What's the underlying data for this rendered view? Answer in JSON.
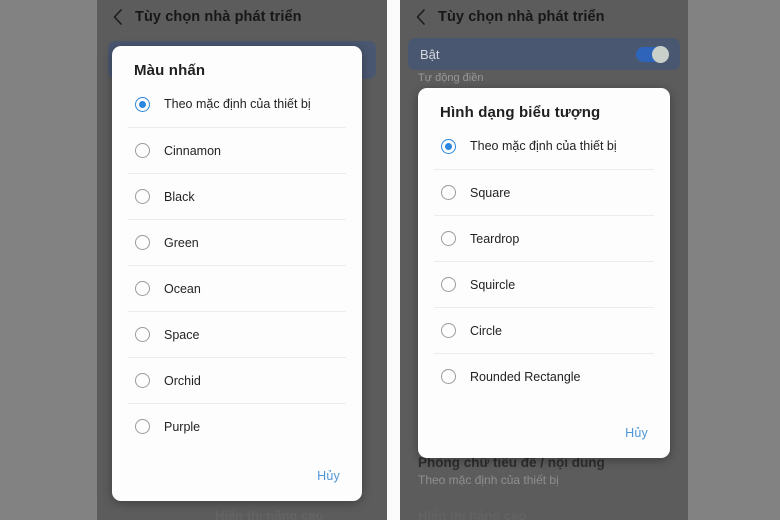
{
  "background": {
    "page_bg": "#828282",
    "screen_dim": "#5c5c5c",
    "gap": "#fbfbfb"
  },
  "theme": {
    "accent_blue": "#2a87e0",
    "link_blue": "#4f96d6",
    "toggle_on": "#2f64bb",
    "card_blue_grey": "#4a5770"
  },
  "left_screen": {
    "appbar": {
      "back_icon": "chevron-left-icon",
      "title": "Tùy chọn nhà phát triển"
    },
    "ghost_bottom": "Hiển thị nâng cao",
    "dialog": {
      "title": "Màu nhấn",
      "options": [
        {
          "label": "Theo mặc định của thiết bị",
          "selected": true
        },
        {
          "label": "Cinnamon",
          "selected": false
        },
        {
          "label": "Black",
          "selected": false
        },
        {
          "label": "Green",
          "selected": false
        },
        {
          "label": "Ocean",
          "selected": false
        },
        {
          "label": "Space",
          "selected": false
        },
        {
          "label": "Orchid",
          "selected": false
        },
        {
          "label": "Purple",
          "selected": false
        }
      ],
      "cancel_label": "Hủy"
    }
  },
  "right_screen": {
    "appbar": {
      "back_icon": "chevron-left-icon",
      "title": "Tùy chọn nhà phát triển"
    },
    "toggle_row": {
      "label": "Bật",
      "state": "on"
    },
    "subtitle_autofill": "Tự động điền",
    "bottom_item": {
      "title": "Phông chữ tiêu đề / nội dung",
      "subtitle": "Theo mặc định của thiết bị"
    },
    "ghost_bottom": "Hiển thị nâng cao",
    "dialog": {
      "title": "Hình dạng biểu tượng",
      "options": [
        {
          "label": "Theo mặc định của thiết bị",
          "selected": true
        },
        {
          "label": "Square",
          "selected": false
        },
        {
          "label": "Teardrop",
          "selected": false
        },
        {
          "label": "Squircle",
          "selected": false
        },
        {
          "label": "Circle",
          "selected": false
        },
        {
          "label": "Rounded Rectangle",
          "selected": false
        }
      ],
      "cancel_label": "Hủy"
    }
  }
}
